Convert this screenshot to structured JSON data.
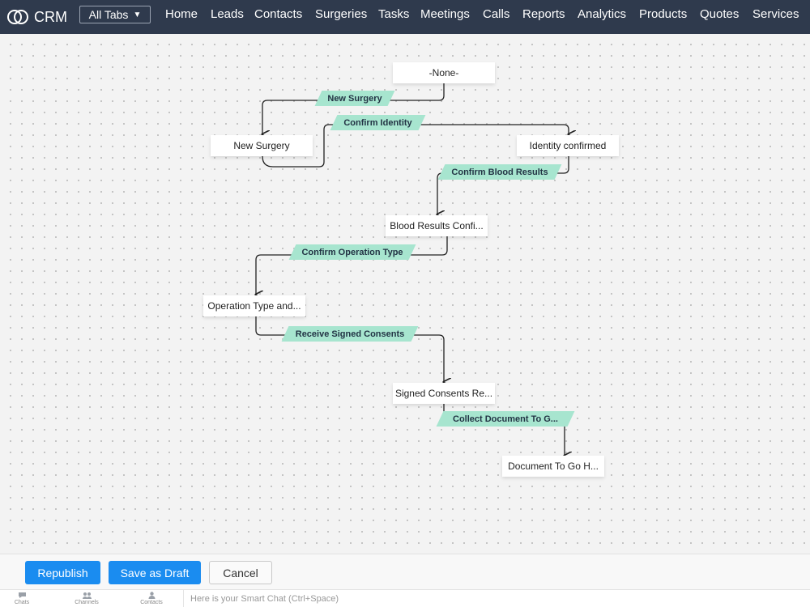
{
  "app": {
    "name": "CRM"
  },
  "nav": {
    "all_tabs": "All Tabs",
    "items": [
      "Home",
      "Leads",
      "Contacts",
      "Surgeries",
      "Tasks",
      "Meetings",
      "Calls",
      "Reports",
      "Analytics",
      "Products",
      "Quotes",
      "Services"
    ]
  },
  "flow": {
    "states": [
      "-None-",
      "New Surgery",
      "Identity confirmed",
      "Blood Results Confi...",
      "Operation Type and...",
      "Signed Consents Re...",
      "Document To Go H..."
    ],
    "transitions": [
      "New Surgery",
      "Confirm Identity",
      "Confirm Blood Results",
      "Confirm Operation Type",
      "Receive Signed Consents",
      "Collect Document To G..."
    ]
  },
  "actions": {
    "republish": "Republish",
    "save_draft": "Save as Draft",
    "cancel": "Cancel"
  },
  "chat": {
    "tabs": [
      "Chats",
      "Channels",
      "Contacts"
    ],
    "placeholder": "Here is your Smart Chat (Ctrl+Space)"
  },
  "colors": {
    "nav_bg": "#2f3a4d",
    "transition_bg": "#a7e5cf",
    "primary": "#1a8cf0"
  }
}
